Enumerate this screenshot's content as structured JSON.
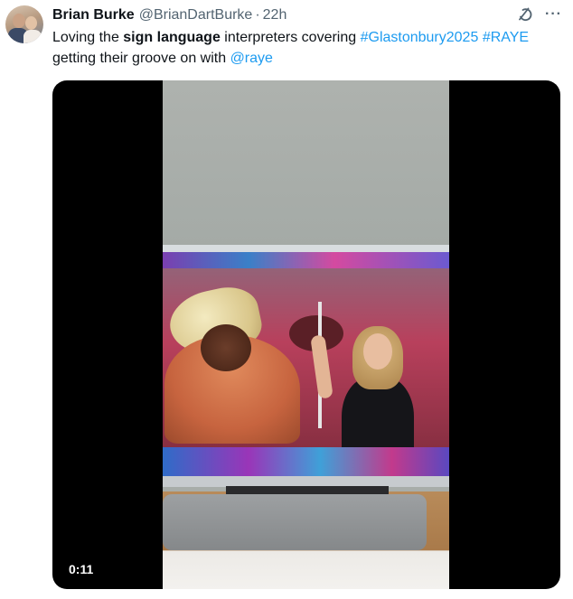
{
  "tweet": {
    "display_name": "Brian Burke",
    "handle": "@BrianDartBurke",
    "separator": "·",
    "timestamp": "22h",
    "more_label": "···",
    "text_segments": [
      {
        "text": "Loving the ",
        "style": "normal"
      },
      {
        "text": "sign language",
        "style": "bold"
      },
      {
        "text": " interpreters covering ",
        "style": "normal"
      },
      {
        "text": "#Glastonbury2025",
        "style": "link"
      },
      {
        "text": " ",
        "style": "normal"
      },
      {
        "text": "#RAYE",
        "style": "link"
      },
      {
        "text": " getting their groove on with ",
        "style": "normal"
      },
      {
        "text": "@raye",
        "style": "link"
      }
    ]
  },
  "icons": {
    "avatar": "user-avatar",
    "grok": "grok-icon",
    "more": "more-icon"
  },
  "media": {
    "duration": "0:11"
  },
  "colors": {
    "link": "#1d9bf0",
    "secondary_text": "#536471",
    "primary_text": "#0f1419"
  }
}
